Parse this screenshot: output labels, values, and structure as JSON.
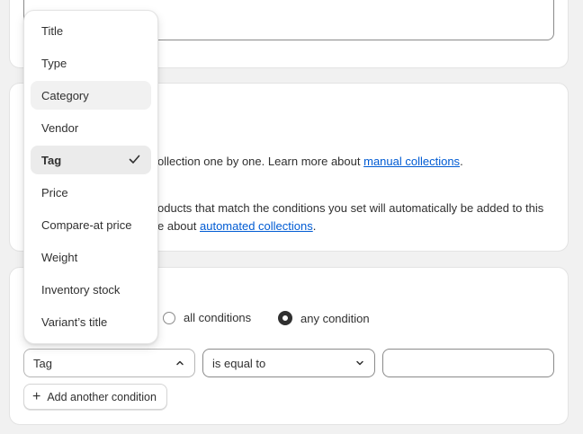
{
  "manual_section": {
    "description_start": "ollection one by one. Learn more about ",
    "link_text": "manual collections",
    "description_end": "."
  },
  "automated_section": {
    "line1": "oducts that match the conditions you set will automatically be added to this",
    "line2_start": "e about ",
    "link_text": "automated collections",
    "line2_end": "."
  },
  "conditions": {
    "match_options": [
      {
        "label": "all conditions",
        "checked": false
      },
      {
        "label": "any condition",
        "checked": true
      }
    ],
    "field_value": "Tag",
    "operator_value": "is equal to",
    "value_input": "",
    "add_button_label": "Add another condition"
  },
  "dropdown": {
    "items": [
      {
        "label": "Title"
      },
      {
        "label": "Type"
      },
      {
        "label": "Category",
        "state": "hover"
      },
      {
        "label": "Vendor"
      },
      {
        "label": "Tag",
        "state": "selected"
      },
      {
        "label": "Price"
      },
      {
        "label": "Compare-at price"
      },
      {
        "label": "Weight"
      },
      {
        "label": "Inventory stock"
      },
      {
        "label": "Variant’s title"
      }
    ]
  },
  "icons": {
    "selected_item": "checkmark-icon",
    "field_select": "chevron-up-icon",
    "operator_select": "chevron-down-icon",
    "add_button": "plus-icon"
  },
  "colors": {
    "link": "#005bd3",
    "text": "#303030",
    "page_bg": "#f1f1f1",
    "hover_bg": "#f1f1f1",
    "selected_bg": "#ebebeb"
  }
}
